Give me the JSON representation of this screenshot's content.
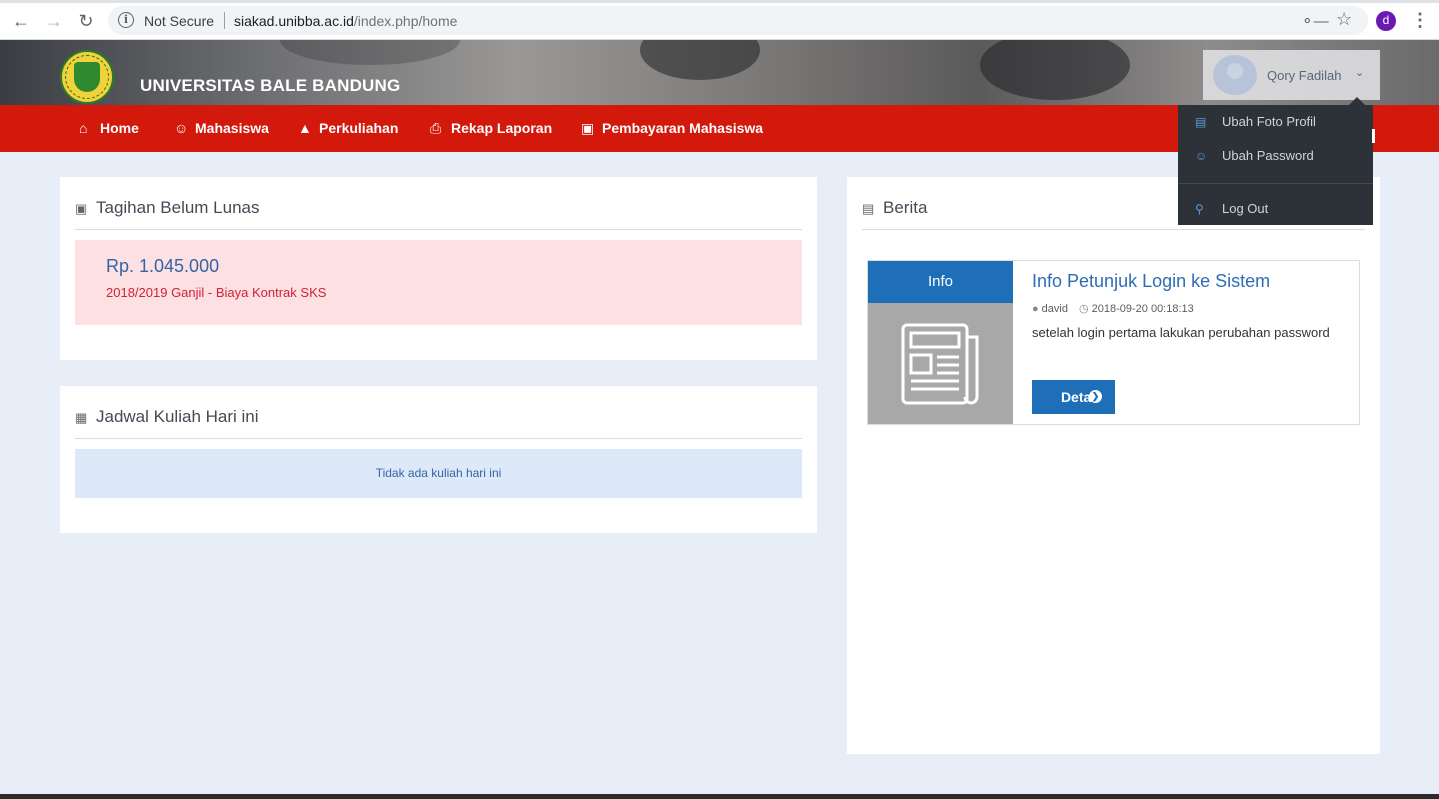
{
  "browser": {
    "security_label": "Not Secure",
    "url_host": "siakad.unibba.ac.id",
    "url_path": "/index.php/home",
    "profile_initial": "d"
  },
  "header": {
    "university_name": "UNIVERSITAS BALE BANDUNG",
    "user_name": "Qory Fadilah"
  },
  "nav": {
    "items": [
      {
        "label": "Home",
        "icon": "home-icon"
      },
      {
        "label": "Mahasiswa",
        "icon": "user-icon"
      },
      {
        "label": "Perkuliahan",
        "icon": "graduation-cap-icon"
      },
      {
        "label": "Rekap Laporan",
        "icon": "printer-icon"
      },
      {
        "label": "Pembayaran Mahasiswa",
        "icon": "money-icon"
      }
    ]
  },
  "user_menu": {
    "items": [
      {
        "label": "Ubah Foto Profil",
        "icon": "image-icon"
      },
      {
        "label": "Ubah Password",
        "icon": "user-icon"
      },
      {
        "label": "Log Out",
        "icon": "key-icon"
      }
    ]
  },
  "tagihan": {
    "title": "Tagihan Belum Lunas",
    "amount": "Rp. 1.045.000",
    "description": "2018/2019 Ganjil - Biaya Kontrak SKS"
  },
  "jadwal": {
    "title": "Jadwal Kuliah Hari ini",
    "empty_message": "Tidak ada kuliah hari ini"
  },
  "berita": {
    "title": "Berita",
    "news": [
      {
        "tag": "Info",
        "title": "Info Petunjuk Login ke Sistem",
        "author": "david",
        "datetime": "2018-09-20 00:18:13",
        "body": "setelah login pertama lakukan perubahan password",
        "button_label": "Detail"
      }
    ]
  },
  "colors": {
    "nav_red": "#d3190c",
    "primary_blue": "#1e6fb7",
    "page_bg": "#e7eef8",
    "dropdown_bg": "#2d3238"
  }
}
